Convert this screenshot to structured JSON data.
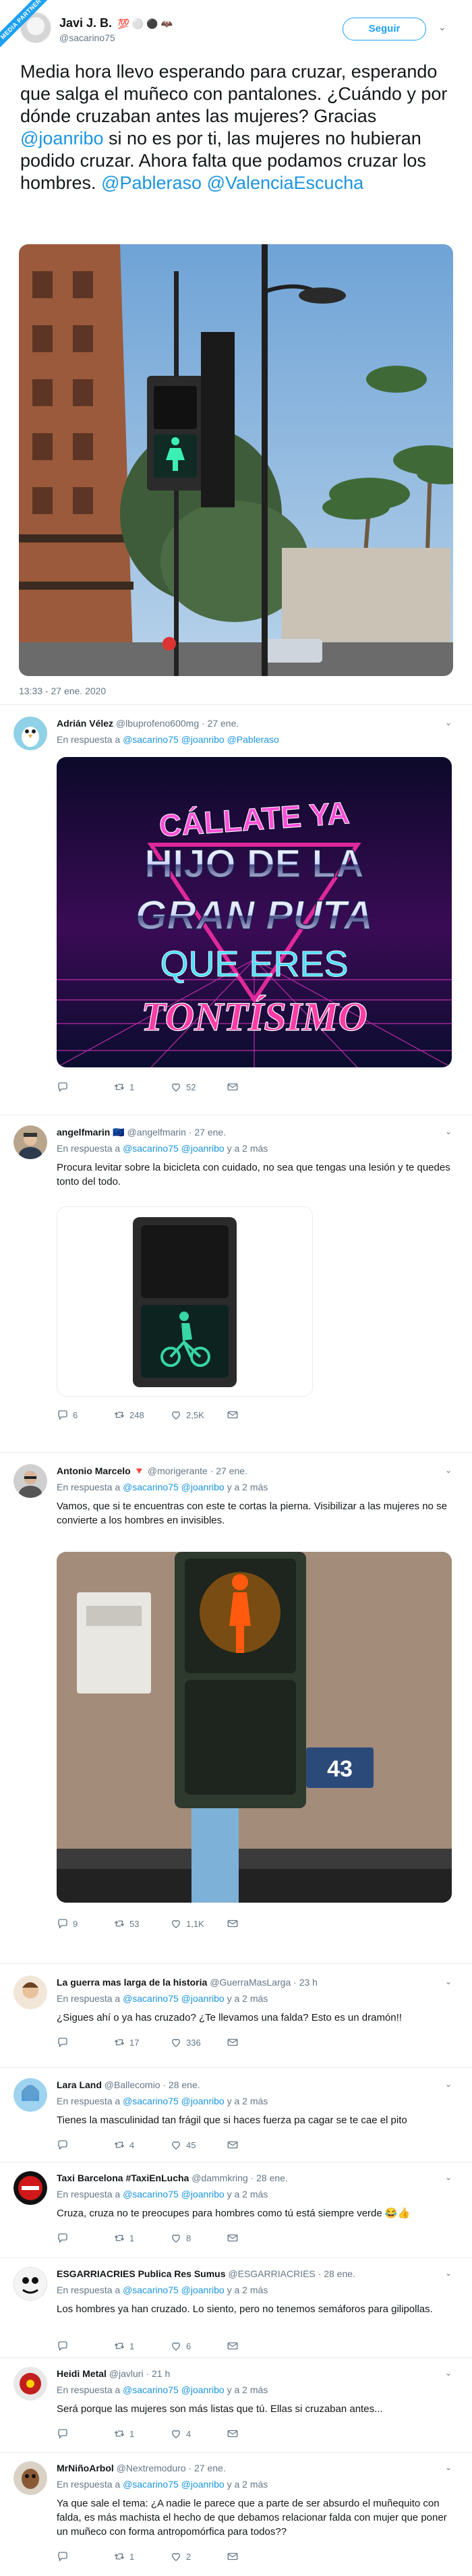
{
  "ribbon": "MEDIA PARTNER",
  "header": {
    "name": "Javi J. B.",
    "emojis": "💯 ⚪ ⚫ 🦇",
    "handle": "@sacarino75",
    "follow_label": "Seguir"
  },
  "tweet": {
    "text_before": "Media hora llevo esperando para cruzar, esperando que salga el muñeco con pantalones. ¿Cuándo y por dónde cruzaban antes las mujeres? Gracias ",
    "mention1": "@joanribo",
    "text_middle": " si no es por ti, las mujeres no hubieran podido cruzar. Ahora falta que podamos cruzar los hombres. ",
    "mention2": "@Pableraso",
    "mention3": "@ValenciaEscucha",
    "timestamp": "13:33 - 27 ene. 2020"
  },
  "replies": [
    {
      "name": "Adrián Vélez",
      "handle": "@lbuprofeno600mg",
      "time": "· 27 ene.",
      "reply_prefix": "En respuesta a",
      "reply_to": "@sacarino75 @joanribo @Pableraso",
      "text": "",
      "image_text": [
        "CÁLLATE YA",
        "HIJO DE LA",
        "GRAN PUTA",
        "QUE ERES",
        "TONTÍSIMO"
      ],
      "counts": {
        "replies": "",
        "retweets": "1",
        "likes": "52"
      },
      "avatar": "penguin-avatar"
    },
    {
      "name": "angelfmarin",
      "flag": "🇪🇺",
      "handle": "@angelfmarin",
      "time": "· 27 ene.",
      "reply_prefix": "En respuesta a",
      "reply_to": "@sacarino75 @joanribo",
      "reply_suffix": "y a 2 más",
      "text": "Procura levitar sobre la bicicleta con cuidado, no sea que tengas una lesión y te quedes tonto del todo.",
      "counts": {
        "replies": "6",
        "retweets": "248",
        "likes": "2,5K"
      }
    },
    {
      "name": "Antonio Marcelo",
      "flag": "🔻",
      "handle": "@morigerante",
      "time": "· 27 ene.",
      "reply_prefix": "En respuesta a",
      "reply_to": "@sacarino75 @joanribo",
      "reply_suffix": "y a 2 más",
      "text": "Vamos, que si te encuentras con este te cortas la pierna. Visibilizar a las mujeres no se convierte a los hombres en invisibles.",
      "plate": "43",
      "counts": {
        "replies": "9",
        "retweets": "53",
        "likes": "1,1K"
      }
    },
    {
      "name": "La guerra mas larga de la historia",
      "handle": "@GuerraMasLarga",
      "time": "· 23 h",
      "reply_prefix": "En respuesta a",
      "reply_to": "@sacarino75 @joanribo",
      "reply_suffix": "y a 2 más",
      "text": "¿Sigues ahí o ya has cruzado? ¿Te llevamos una falda? Esto es un dramón!!",
      "counts": {
        "replies": "",
        "retweets": "17",
        "likes": "336"
      }
    },
    {
      "name": "Lara Land",
      "handle": "@Ballecomio",
      "time": "· 28 ene.",
      "reply_prefix": "En respuesta a",
      "reply_to": "@sacarino75 @joanribo",
      "reply_suffix": "y a 2 más",
      "text": "Tienes la masculinidad tan frágil que si haces fuerza pa cagar se te cae el pito",
      "counts": {
        "replies": "",
        "retweets": "4",
        "likes": "45"
      }
    },
    {
      "name": "Taxi Barcelona #TaxiEnLucha",
      "handle": "@dammkring",
      "time": "· 28 ene.",
      "reply_prefix": "En respuesta a",
      "reply_to": "@sacarino75 @joanribo",
      "reply_suffix": "y a 2 más",
      "text": "Cruza, cruza no te preocupes para hombres como tú está siempre verde 😂👍",
      "counts": {
        "replies": "",
        "retweets": "1",
        "likes": "8"
      }
    },
    {
      "name": "ESGARRIACRIES Publica Res Sumus",
      "handle": "@ESGARRIACRIES",
      "time": "· 28 ene.",
      "reply_prefix": "En respuesta a",
      "reply_to": "@sacarino75 @joanribo",
      "reply_suffix": "y a 2 más",
      "text": "Los hombres ya han cruzado. Lo siento, pero no tenemos semáforos para gilipollas.",
      "counts": {
        "replies": "",
        "retweets": "1",
        "likes": "6"
      }
    },
    {
      "name": "Heidi Metal",
      "handle": "@javluri",
      "time": "· 21 h",
      "reply_prefix": "En respuesta a",
      "reply_to": "@sacarino75 @joanribo",
      "reply_suffix": "y a 2 más",
      "text": "Será porque las mujeres son más listas que tú. Ellas si cruzaban antes...",
      "counts": {
        "replies": "",
        "retweets": "1",
        "likes": "4"
      }
    },
    {
      "name": "MrNiñoArbol",
      "handle": "@Nextremoduro",
      "time": "· 27 ene.",
      "reply_prefix": "En respuesta a",
      "reply_to": "@sacarino75 @joanribo",
      "reply_suffix": "y a 2 más",
      "text": "Ya que sale el tema: ¿A nadie le parece que a parte de ser absurdo el muñequito con falda, es más machista el hecho de que debamos relacionar falda con mujer que poner un muñeco con forma antropomórfica para todos??",
      "counts": {
        "replies": "",
        "retweets": "1",
        "likes": "2"
      }
    }
  ]
}
